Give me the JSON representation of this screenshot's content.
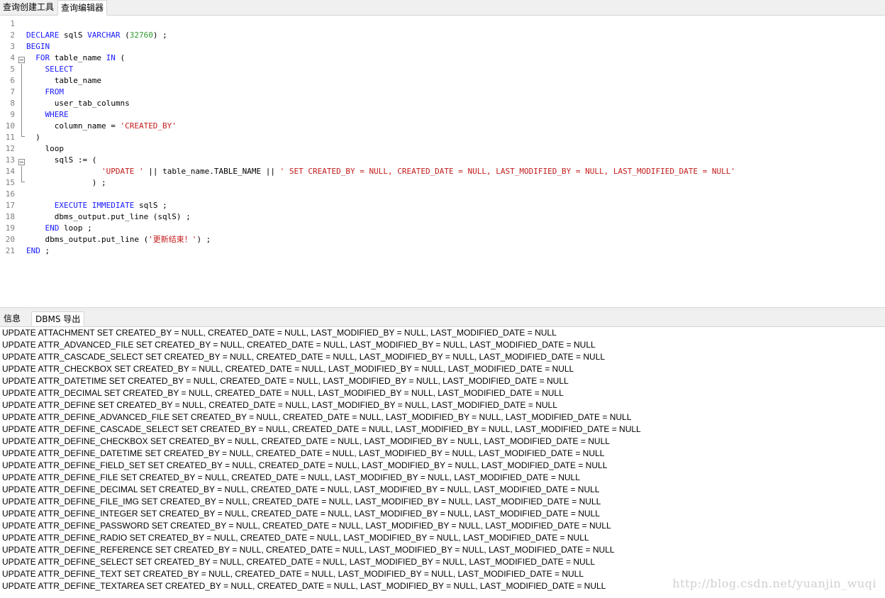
{
  "tabs": {
    "query_builder": "查询创建工具",
    "query_editor": "查询编辑器"
  },
  "editor": {
    "lines": [
      {
        "n": "1",
        "tokens": []
      },
      {
        "n": "2",
        "tokens": [
          [
            "kw",
            "DECLARE"
          ],
          [
            "p",
            " sqlS "
          ],
          [
            "kw",
            "VARCHAR"
          ],
          [
            "p",
            " ("
          ],
          [
            "num",
            "32760"
          ],
          [
            "p",
            ") ;"
          ]
        ]
      },
      {
        "n": "3",
        "tokens": [
          [
            "kw",
            "BEGIN"
          ]
        ]
      },
      {
        "n": "4",
        "tokens": [
          [
            "p",
            "  "
          ],
          [
            "kw",
            "FOR"
          ],
          [
            "p",
            " table_name "
          ],
          [
            "kw",
            "IN"
          ],
          [
            "p",
            " ("
          ]
        ]
      },
      {
        "n": "5",
        "tokens": [
          [
            "p",
            "    "
          ],
          [
            "kw",
            "SELECT"
          ]
        ]
      },
      {
        "n": "6",
        "tokens": [
          [
            "p",
            "      table_name"
          ]
        ]
      },
      {
        "n": "7",
        "tokens": [
          [
            "p",
            "    "
          ],
          [
            "kw",
            "FROM"
          ]
        ]
      },
      {
        "n": "8",
        "tokens": [
          [
            "p",
            "      user_tab_columns"
          ]
        ]
      },
      {
        "n": "9",
        "tokens": [
          [
            "p",
            "    "
          ],
          [
            "kw",
            "WHERE"
          ]
        ]
      },
      {
        "n": "10",
        "tokens": [
          [
            "p",
            "      column_name = "
          ],
          [
            "str",
            "'CREATED_BY'"
          ]
        ]
      },
      {
        "n": "11",
        "tokens": [
          [
            "p",
            "  )"
          ]
        ]
      },
      {
        "n": "12",
        "tokens": [
          [
            "p",
            "    loop"
          ]
        ]
      },
      {
        "n": "13",
        "tokens": [
          [
            "p",
            "      sqlS := ("
          ]
        ]
      },
      {
        "n": "14",
        "tokens": [
          [
            "p",
            "                "
          ],
          [
            "str",
            "'UPDATE '"
          ],
          [
            "p",
            " || table_name.TABLE_NAME || "
          ],
          [
            "str",
            "' SET CREATED_BY = NULL, CREATED_DATE = NULL, LAST_MODIFIED_BY = NULL, LAST_MODIFIED_DATE = NULL'"
          ]
        ]
      },
      {
        "n": "15",
        "tokens": [
          [
            "p",
            "              ) ;"
          ]
        ]
      },
      {
        "n": "16",
        "tokens": []
      },
      {
        "n": "17",
        "tokens": [
          [
            "p",
            "      "
          ],
          [
            "kw",
            "EXECUTE IMMEDIATE"
          ],
          [
            "p",
            " sqlS ;"
          ]
        ]
      },
      {
        "n": "18",
        "tokens": [
          [
            "p",
            "      dbms_output.put_line (sqlS) ;"
          ]
        ]
      },
      {
        "n": "19",
        "tokens": [
          [
            "p",
            "    "
          ],
          [
            "kw",
            "END"
          ],
          [
            "p",
            " loop ;"
          ]
        ]
      },
      {
        "n": "20",
        "tokens": [
          [
            "p",
            "    dbms_output.put_line ("
          ],
          [
            "str",
            "'更新结束！'"
          ],
          [
            "p",
            ") ;"
          ]
        ]
      },
      {
        "n": "21",
        "tokens": [
          [
            "kw",
            "END"
          ],
          [
            "p",
            " ;"
          ]
        ]
      }
    ]
  },
  "bottom_tabs": {
    "info": "信息",
    "dbms_output": "DBMS 导出"
  },
  "output_lines": [
    "UPDATE ATTACHMENT SET CREATED_BY = NULL, CREATED_DATE = NULL, LAST_MODIFIED_BY = NULL, LAST_MODIFIED_DATE = NULL",
    "UPDATE ATTR_ADVANCED_FILE SET CREATED_BY = NULL, CREATED_DATE = NULL, LAST_MODIFIED_BY = NULL, LAST_MODIFIED_DATE = NULL",
    "UPDATE ATTR_CASCADE_SELECT SET CREATED_BY = NULL, CREATED_DATE = NULL, LAST_MODIFIED_BY = NULL, LAST_MODIFIED_DATE = NULL",
    "UPDATE ATTR_CHECKBOX SET CREATED_BY = NULL, CREATED_DATE = NULL, LAST_MODIFIED_BY = NULL, LAST_MODIFIED_DATE = NULL",
    "UPDATE ATTR_DATETIME SET CREATED_BY = NULL, CREATED_DATE = NULL, LAST_MODIFIED_BY = NULL, LAST_MODIFIED_DATE = NULL",
    "UPDATE ATTR_DECIMAL SET CREATED_BY = NULL, CREATED_DATE = NULL, LAST_MODIFIED_BY = NULL, LAST_MODIFIED_DATE = NULL",
    "UPDATE ATTR_DEFINE SET CREATED_BY = NULL, CREATED_DATE = NULL, LAST_MODIFIED_BY = NULL, LAST_MODIFIED_DATE = NULL",
    "UPDATE ATTR_DEFINE_ADVANCED_FILE SET CREATED_BY = NULL, CREATED_DATE = NULL, LAST_MODIFIED_BY = NULL, LAST_MODIFIED_DATE = NULL",
    "UPDATE ATTR_DEFINE_CASCADE_SELECT SET CREATED_BY = NULL, CREATED_DATE = NULL, LAST_MODIFIED_BY = NULL, LAST_MODIFIED_DATE = NULL",
    "UPDATE ATTR_DEFINE_CHECKBOX SET CREATED_BY = NULL, CREATED_DATE = NULL, LAST_MODIFIED_BY = NULL, LAST_MODIFIED_DATE = NULL",
    "UPDATE ATTR_DEFINE_DATETIME SET CREATED_BY = NULL, CREATED_DATE = NULL, LAST_MODIFIED_BY = NULL, LAST_MODIFIED_DATE = NULL",
    "UPDATE ATTR_DEFINE_FIELD_SET SET CREATED_BY = NULL, CREATED_DATE = NULL, LAST_MODIFIED_BY = NULL, LAST_MODIFIED_DATE = NULL",
    "UPDATE ATTR_DEFINE_FILE SET CREATED_BY = NULL, CREATED_DATE = NULL, LAST_MODIFIED_BY = NULL, LAST_MODIFIED_DATE = NULL",
    "UPDATE ATTR_DEFINE_DECIMAL SET CREATED_BY = NULL, CREATED_DATE = NULL, LAST_MODIFIED_BY = NULL, LAST_MODIFIED_DATE = NULL",
    "UPDATE ATTR_DEFINE_FILE_IMG SET CREATED_BY = NULL, CREATED_DATE = NULL, LAST_MODIFIED_BY = NULL, LAST_MODIFIED_DATE = NULL",
    "UPDATE ATTR_DEFINE_INTEGER SET CREATED_BY = NULL, CREATED_DATE = NULL, LAST_MODIFIED_BY = NULL, LAST_MODIFIED_DATE = NULL",
    "UPDATE ATTR_DEFINE_PASSWORD SET CREATED_BY = NULL, CREATED_DATE = NULL, LAST_MODIFIED_BY = NULL, LAST_MODIFIED_DATE = NULL",
    "UPDATE ATTR_DEFINE_RADIO SET CREATED_BY = NULL, CREATED_DATE = NULL, LAST_MODIFIED_BY = NULL, LAST_MODIFIED_DATE = NULL",
    "UPDATE ATTR_DEFINE_REFERENCE SET CREATED_BY = NULL, CREATED_DATE = NULL, LAST_MODIFIED_BY = NULL, LAST_MODIFIED_DATE = NULL",
    "UPDATE ATTR_DEFINE_SELECT SET CREATED_BY = NULL, CREATED_DATE = NULL, LAST_MODIFIED_BY = NULL, LAST_MODIFIED_DATE = NULL",
    "UPDATE ATTR_DEFINE_TEXT SET CREATED_BY = NULL, CREATED_DATE = NULL, LAST_MODIFIED_BY = NULL, LAST_MODIFIED_DATE = NULL",
    "UPDATE ATTR_DEFINE_TEXTAREA SET CREATED_BY = NULL, CREATED_DATE = NULL, LAST_MODIFIED_BY = NULL, LAST_MODIFIED_DATE = NULL"
  ],
  "watermark": "http://blog.csdn.net/yuanjin_wuqi",
  "colors": {
    "keyword": "#1a1aff",
    "string": "#c31b1b",
    "number": "#2e9c2e",
    "line_number": "#7f7f7f"
  }
}
